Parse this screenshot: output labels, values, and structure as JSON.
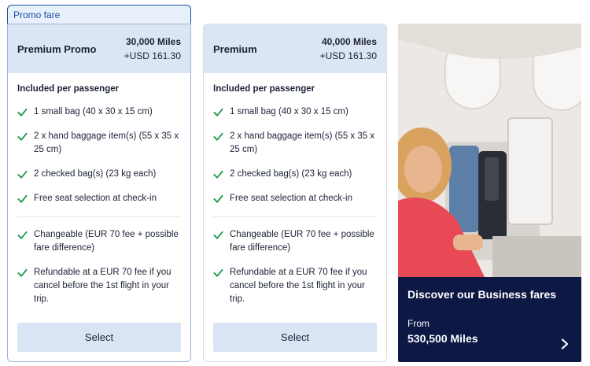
{
  "tag": {
    "label": "Promo fare"
  },
  "cards": [
    {
      "name": "Premium Promo",
      "miles": "30,000 Miles",
      "usd": "+USD 161.30",
      "included_heading": "Included per passenger",
      "items": [
        "1 small bag (40 x 30 x 15 cm)",
        "2 x hand baggage item(s) (55 x 35 x 25 cm)",
        "2 checked bag(s) (23 kg each)",
        "Free seat selection at check-in"
      ],
      "conditions": [
        "Changeable (EUR 70 fee + possible fare difference)",
        "Refundable at a EUR 70 fee if you cancel before the 1st flight in your trip."
      ],
      "button": "Select"
    },
    {
      "name": "Premium",
      "miles": "40,000 Miles",
      "usd": "+USD 161.30",
      "included_heading": "Included per passenger",
      "items": [
        "1 small bag (40 x 30 x 15 cm)",
        "2 x hand baggage item(s) (55 x 35 x 25 cm)",
        "2 checked bag(s) (23 kg each)",
        "Free seat selection at check-in"
      ],
      "conditions": [
        "Changeable (EUR 70 fee + possible fare difference)",
        "Refundable at a EUR 70 fee if you cancel before the 1st flight in your trip."
      ],
      "button": "Select"
    }
  ],
  "promo": {
    "title": "Discover our Business fares",
    "from": "From",
    "miles": "530,500 Miles",
    "icon": "chevron-right-icon"
  },
  "colors": {
    "accent": "#1b4fa0",
    "check": "#1f9a4a",
    "header_bg": "#dbe5f4",
    "button_bg": "#d9e4f4",
    "panel_bg": "#0d1845"
  }
}
